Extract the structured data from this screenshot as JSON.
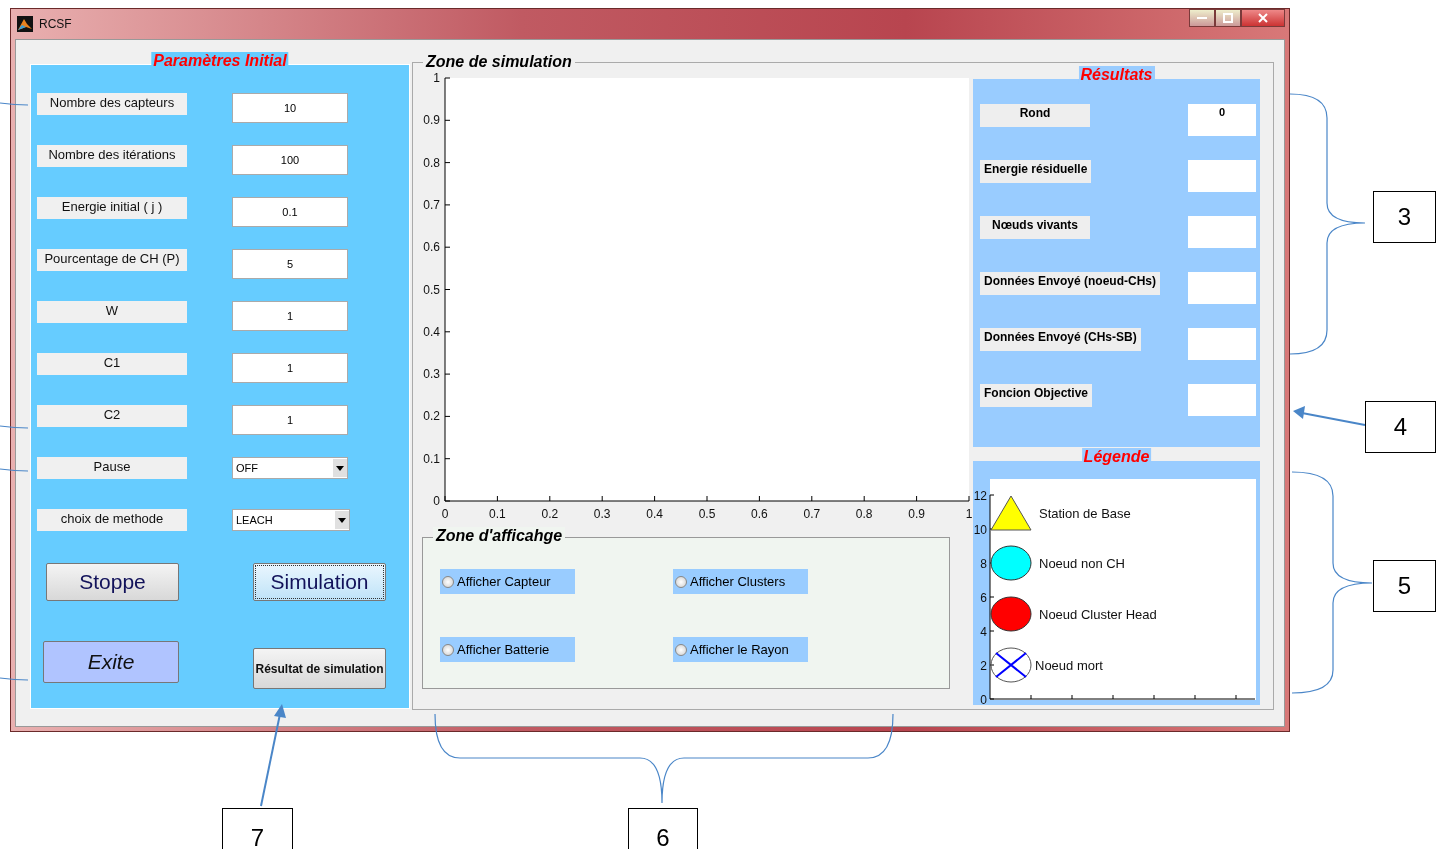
{
  "window": {
    "title": "RCSF"
  },
  "parameters": {
    "title": "Paramètres Initial",
    "fields": [
      {
        "kind": "text",
        "label": "Nombre des capteurs",
        "value": "10"
      },
      {
        "kind": "text",
        "label": "Nombre des itérations",
        "value": "100"
      },
      {
        "kind": "text",
        "label": "Energie initial ( j )",
        "value": "0.1"
      },
      {
        "kind": "text",
        "label": "Pourcentage de CH (P)",
        "value": "5"
      },
      {
        "kind": "text",
        "label": "W",
        "value": "1"
      },
      {
        "kind": "text",
        "label": "C1",
        "value": "1"
      },
      {
        "kind": "text",
        "label": "C2",
        "value": "1"
      },
      {
        "kind": "select",
        "label": "Pause",
        "value": "OFF"
      },
      {
        "kind": "select",
        "label": "choix de methode",
        "value": "LEACH"
      }
    ],
    "buttons": [
      {
        "kind": "plain",
        "label": "Stoppe"
      },
      {
        "kind": "focused",
        "label": "Simulation"
      },
      {
        "kind": "accent",
        "label": "Exite"
      },
      {
        "kind": "small",
        "label": "Résultat de simulation"
      }
    ]
  },
  "simulation_zone": {
    "title": "Zone de simulation",
    "plot": {
      "x_tick_labels": [
        "0",
        "0.1",
        "0.2",
        "0.3",
        "0.4",
        "0.5",
        "0.6",
        "0.7",
        "0.8",
        "0.9",
        "1"
      ],
      "y_tick_labels": [
        "1",
        "0.9",
        "0.8",
        "0.7",
        "0.6",
        "0.5",
        "0.4",
        "0.3",
        "0.2",
        "0.1",
        "0"
      ]
    },
    "display_zone": {
      "title": "Zone d'afficahge",
      "options": [
        {
          "label": "Afficher Capteur",
          "selected": false
        },
        {
          "label": "Afficher Clusters",
          "selected": false
        },
        {
          "label": "Afficher  Batterie",
          "selected": false
        },
        {
          "label": "Afficher le Rayon",
          "selected": false
        }
      ]
    }
  },
  "results": {
    "title": "Résultats",
    "rows": [
      {
        "label": "Rond",
        "value": "0"
      },
      {
        "label": "Energie résiduelle"
      },
      {
        "label": "Nœuds vivants"
      },
      {
        "label": "Données Envoyé (noeud-CHs)"
      },
      {
        "label": "Données Envoyé (CHs-SB)"
      },
      {
        "label": "Foncion Objective"
      }
    ]
  },
  "legend": {
    "title": "Légende",
    "y_tick_labels": [
      "12",
      "10",
      "8",
      "6",
      "4",
      "2",
      "0"
    ],
    "entries": [
      {
        "kind": "triangle",
        "label": "Station de Base",
        "color": "#ffff00"
      },
      {
        "kind": "circle",
        "label": "Noeud non CH",
        "color": "#00ffff"
      },
      {
        "kind": "circle",
        "label": "Noeud Cluster Head",
        "color": "#ff0000"
      },
      {
        "kind": "crossed",
        "label": "Noeud mort",
        "color": "#0000ff"
      }
    ]
  },
  "annotations": [
    {
      "number": "3"
    },
    {
      "number": "4"
    },
    {
      "number": "5"
    },
    {
      "number": "6"
    },
    {
      "number": "7"
    }
  ]
}
